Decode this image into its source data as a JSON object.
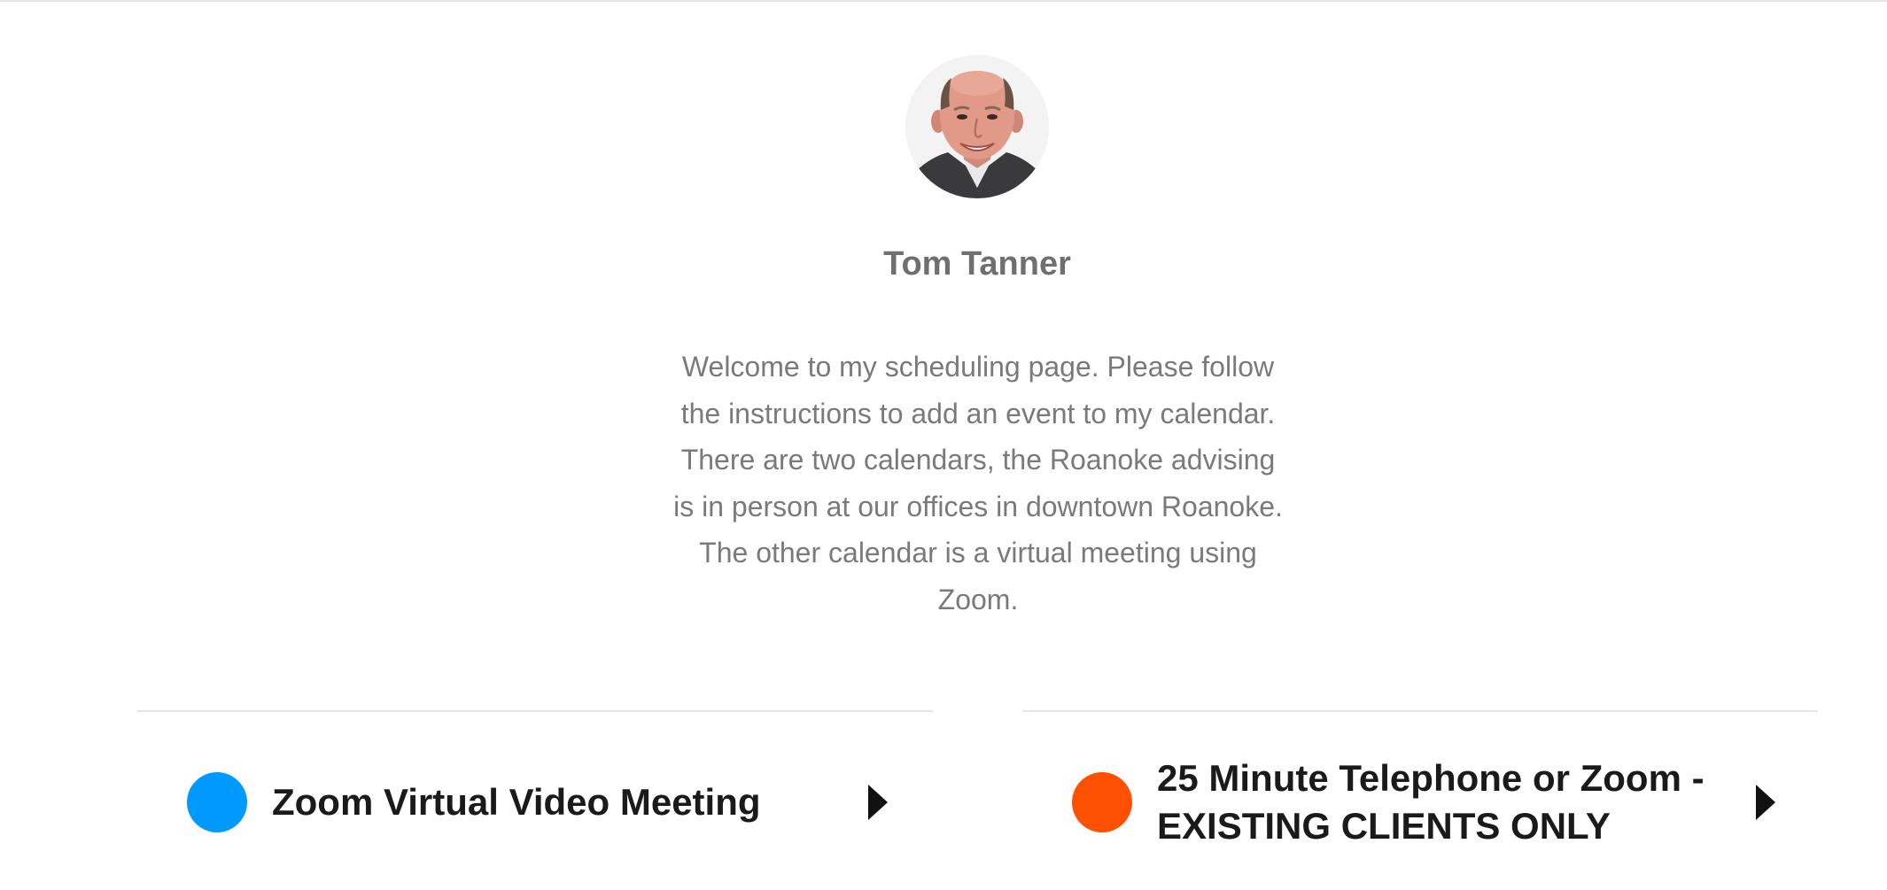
{
  "profile": {
    "name": "Tom Tanner",
    "avatar_icon": "profile-photo",
    "welcome_text": "Welcome to my scheduling page. Please follow the instructions to add an event to my calendar. There are two calendars, the Roanoke advising is in person at our offices in downtown Roanoke. The other calendar is a virtual meeting using Zoom."
  },
  "events": [
    {
      "title": "Zoom Virtual Video Meeting",
      "color": "#0099ff",
      "arrow_icon": "caret-right-icon"
    },
    {
      "title": "25 Minute Telephone or Zoom - EXISTING CLIENTS ONLY",
      "color": "#ff4f00",
      "arrow_icon": "caret-right-icon"
    }
  ],
  "colors": {
    "divider": "#e6e6e6",
    "name_text": "#6f6f6f",
    "body_text": "#7a7a7a",
    "title_text": "#1a1a1a"
  }
}
